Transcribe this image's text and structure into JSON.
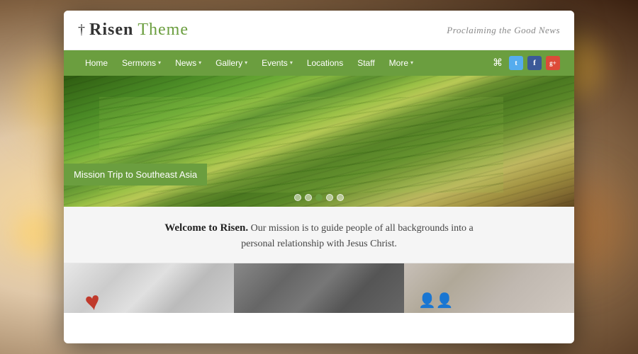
{
  "site": {
    "logo_cross": "†",
    "logo_risen": "Risen",
    "logo_theme": " Theme",
    "tagline": "Proclaiming the Good News"
  },
  "nav": {
    "items": [
      {
        "label": "Home",
        "has_dropdown": false
      },
      {
        "label": "Sermons",
        "has_dropdown": true
      },
      {
        "label": "News",
        "has_dropdown": true
      },
      {
        "label": "Gallery",
        "has_dropdown": true
      },
      {
        "label": "Events",
        "has_dropdown": true
      },
      {
        "label": "Locations",
        "has_dropdown": false
      },
      {
        "label": "Staff",
        "has_dropdown": false
      },
      {
        "label": "More",
        "has_dropdown": true
      }
    ],
    "social": [
      "RSS",
      "T",
      "f",
      "g+"
    ]
  },
  "hero": {
    "caption": "Mission Trip to Southeast Asia",
    "dots": [
      false,
      false,
      true,
      false,
      false
    ]
  },
  "welcome": {
    "bold": "Welcome to Risen.",
    "text": " Our mission is to guide people of all backgrounds into a personal relationship with Jesus Christ."
  },
  "cards": [
    {
      "id": "card-1",
      "type": "love"
    },
    {
      "id": "card-2",
      "type": "faith"
    },
    {
      "id": "card-3",
      "type": "people"
    }
  ]
}
